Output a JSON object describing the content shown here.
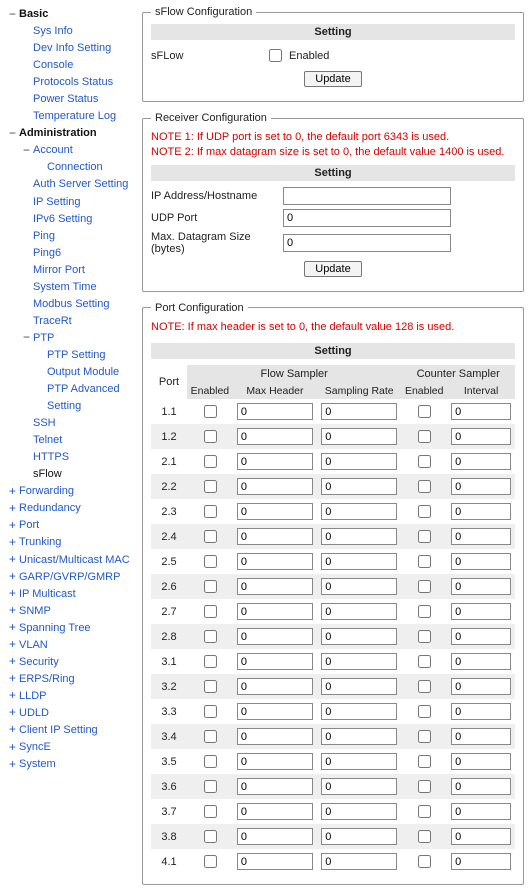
{
  "nav": [
    {
      "label": "Basic",
      "bold": true,
      "toggle": "-",
      "children": [
        {
          "label": "Sys Info"
        },
        {
          "label": "Dev Info Setting"
        },
        {
          "label": "Console"
        },
        {
          "label": "Protocols Status"
        },
        {
          "label": "Power Status"
        },
        {
          "label": "Temperature Log"
        }
      ]
    },
    {
      "label": "Administration",
      "bold": true,
      "toggle": "-",
      "children": [
        {
          "label": "Account",
          "toggle": "-",
          "children": [
            {
              "label": "Connection"
            }
          ]
        },
        {
          "label": "Auth Server Setting"
        },
        {
          "label": "IP Setting"
        },
        {
          "label": "IPv6 Setting"
        },
        {
          "label": "Ping"
        },
        {
          "label": "Ping6"
        },
        {
          "label": "Mirror Port"
        },
        {
          "label": "System Time"
        },
        {
          "label": "Modbus Setting"
        },
        {
          "label": "TraceRt"
        },
        {
          "label": "PTP",
          "toggle": "-",
          "children": [
            {
              "label": "PTP Setting"
            },
            {
              "label": "Output Module"
            },
            {
              "label": "PTP Advanced Setting"
            }
          ]
        },
        {
          "label": "SSH"
        },
        {
          "label": "Telnet"
        },
        {
          "label": "HTTPS"
        },
        {
          "label": "sFlow",
          "sel": true
        }
      ]
    },
    {
      "label": "Forwarding",
      "toggle": "+"
    },
    {
      "label": "Redundancy",
      "toggle": "+"
    },
    {
      "label": "Port",
      "toggle": "+"
    },
    {
      "label": "Trunking",
      "toggle": "+"
    },
    {
      "label": "Unicast/Multicast MAC",
      "toggle": "+"
    },
    {
      "label": "GARP/GVRP/GMRP",
      "toggle": "+"
    },
    {
      "label": "IP Multicast",
      "toggle": "+"
    },
    {
      "label": "SNMP",
      "toggle": "+"
    },
    {
      "label": "Spanning Tree",
      "toggle": "+"
    },
    {
      "label": "VLAN",
      "toggle": "+"
    },
    {
      "label": "Security",
      "toggle": "+"
    },
    {
      "label": "ERPS/Ring",
      "toggle": "+"
    },
    {
      "label": "LLDP",
      "toggle": "+"
    },
    {
      "label": "UDLD",
      "toggle": "+"
    },
    {
      "label": "Client IP Setting",
      "toggle": "+"
    },
    {
      "label": "SyncE",
      "toggle": "+"
    },
    {
      "label": "System",
      "toggle": "+"
    }
  ],
  "sflow": {
    "legend": "sFlow Configuration",
    "setting": "Setting",
    "label": "sFLow",
    "enabled_label": "Enabled",
    "enabled": false,
    "update": "Update"
  },
  "receiver": {
    "legend": "Receiver Configuration",
    "note1": "NOTE 1: If UDP port is set to 0, the default port 6343 is used.",
    "note2": "NOTE 2: If max datagram size is set to 0, the default value 1400 is used.",
    "setting": "Setting",
    "ip_label": "IP Address/Hostname",
    "ip_value": "",
    "udp_label": "UDP Port",
    "udp_value": "0",
    "dg_label": "Max. Datagram Size (bytes)",
    "dg_value": "0",
    "update": "Update"
  },
  "portconf": {
    "legend": "Port Configuration",
    "note": "NOTE: If max header is set to 0, the default value 128 is used.",
    "setting": "Setting",
    "col_port": "Port",
    "group_flow": "Flow Sampler",
    "group_counter": "Counter Sampler",
    "col_enabled": "Enabled",
    "col_maxhdr": "Max Header",
    "col_srate": "Sampling Rate",
    "col_interval": "Interval",
    "rows": [
      {
        "port": "1.1",
        "fen": false,
        "mh": "0",
        "sr": "0",
        "cen": false,
        "iv": "0"
      },
      {
        "port": "1.2",
        "fen": false,
        "mh": "0",
        "sr": "0",
        "cen": false,
        "iv": "0"
      },
      {
        "port": "2.1",
        "fen": false,
        "mh": "0",
        "sr": "0",
        "cen": false,
        "iv": "0"
      },
      {
        "port": "2.2",
        "fen": false,
        "mh": "0",
        "sr": "0",
        "cen": false,
        "iv": "0"
      },
      {
        "port": "2.3",
        "fen": false,
        "mh": "0",
        "sr": "0",
        "cen": false,
        "iv": "0"
      },
      {
        "port": "2.4",
        "fen": false,
        "mh": "0",
        "sr": "0",
        "cen": false,
        "iv": "0"
      },
      {
        "port": "2.5",
        "fen": false,
        "mh": "0",
        "sr": "0",
        "cen": false,
        "iv": "0"
      },
      {
        "port": "2.6",
        "fen": false,
        "mh": "0",
        "sr": "0",
        "cen": false,
        "iv": "0"
      },
      {
        "port": "2.7",
        "fen": false,
        "mh": "0",
        "sr": "0",
        "cen": false,
        "iv": "0"
      },
      {
        "port": "2.8",
        "fen": false,
        "mh": "0",
        "sr": "0",
        "cen": false,
        "iv": "0"
      },
      {
        "port": "3.1",
        "fen": false,
        "mh": "0",
        "sr": "0",
        "cen": false,
        "iv": "0"
      },
      {
        "port": "3.2",
        "fen": false,
        "mh": "0",
        "sr": "0",
        "cen": false,
        "iv": "0"
      },
      {
        "port": "3.3",
        "fen": false,
        "mh": "0",
        "sr": "0",
        "cen": false,
        "iv": "0"
      },
      {
        "port": "3.4",
        "fen": false,
        "mh": "0",
        "sr": "0",
        "cen": false,
        "iv": "0"
      },
      {
        "port": "3.5",
        "fen": false,
        "mh": "0",
        "sr": "0",
        "cen": false,
        "iv": "0"
      },
      {
        "port": "3.6",
        "fen": false,
        "mh": "0",
        "sr": "0",
        "cen": false,
        "iv": "0"
      },
      {
        "port": "3.7",
        "fen": false,
        "mh": "0",
        "sr": "0",
        "cen": false,
        "iv": "0"
      },
      {
        "port": "3.8",
        "fen": false,
        "mh": "0",
        "sr": "0",
        "cen": false,
        "iv": "0"
      },
      {
        "port": "4.1",
        "fen": false,
        "mh": "0",
        "sr": "0",
        "cen": false,
        "iv": "0"
      }
    ]
  }
}
